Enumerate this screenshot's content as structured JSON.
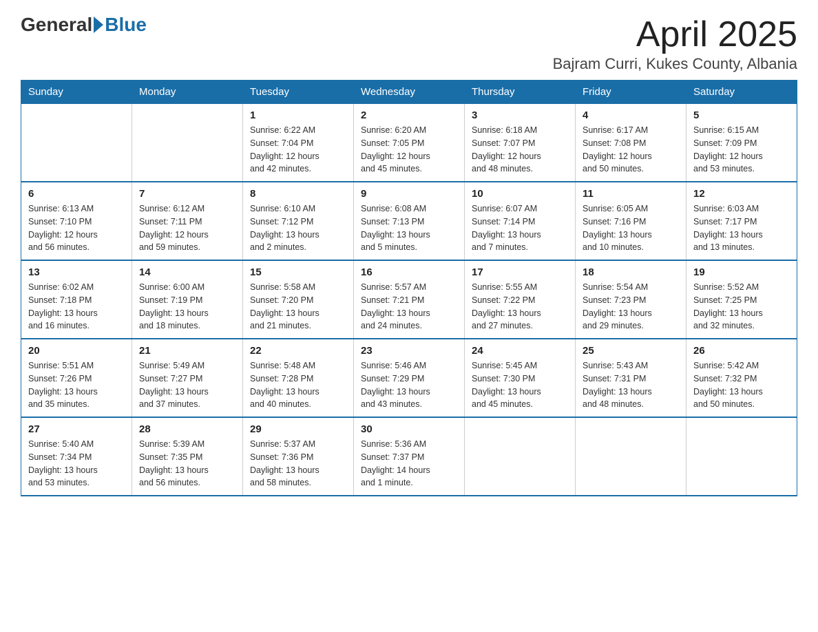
{
  "header": {
    "logo_general": "General",
    "logo_blue": "Blue",
    "month_title": "April 2025",
    "subtitle": "Bajram Curri, Kukes County, Albania"
  },
  "weekdays": [
    "Sunday",
    "Monday",
    "Tuesday",
    "Wednesday",
    "Thursday",
    "Friday",
    "Saturday"
  ],
  "weeks": [
    [
      {
        "day": "",
        "info": ""
      },
      {
        "day": "",
        "info": ""
      },
      {
        "day": "1",
        "info": "Sunrise: 6:22 AM\nSunset: 7:04 PM\nDaylight: 12 hours\nand 42 minutes."
      },
      {
        "day": "2",
        "info": "Sunrise: 6:20 AM\nSunset: 7:05 PM\nDaylight: 12 hours\nand 45 minutes."
      },
      {
        "day": "3",
        "info": "Sunrise: 6:18 AM\nSunset: 7:07 PM\nDaylight: 12 hours\nand 48 minutes."
      },
      {
        "day": "4",
        "info": "Sunrise: 6:17 AM\nSunset: 7:08 PM\nDaylight: 12 hours\nand 50 minutes."
      },
      {
        "day": "5",
        "info": "Sunrise: 6:15 AM\nSunset: 7:09 PM\nDaylight: 12 hours\nand 53 minutes."
      }
    ],
    [
      {
        "day": "6",
        "info": "Sunrise: 6:13 AM\nSunset: 7:10 PM\nDaylight: 12 hours\nand 56 minutes."
      },
      {
        "day": "7",
        "info": "Sunrise: 6:12 AM\nSunset: 7:11 PM\nDaylight: 12 hours\nand 59 minutes."
      },
      {
        "day": "8",
        "info": "Sunrise: 6:10 AM\nSunset: 7:12 PM\nDaylight: 13 hours\nand 2 minutes."
      },
      {
        "day": "9",
        "info": "Sunrise: 6:08 AM\nSunset: 7:13 PM\nDaylight: 13 hours\nand 5 minutes."
      },
      {
        "day": "10",
        "info": "Sunrise: 6:07 AM\nSunset: 7:14 PM\nDaylight: 13 hours\nand 7 minutes."
      },
      {
        "day": "11",
        "info": "Sunrise: 6:05 AM\nSunset: 7:16 PM\nDaylight: 13 hours\nand 10 minutes."
      },
      {
        "day": "12",
        "info": "Sunrise: 6:03 AM\nSunset: 7:17 PM\nDaylight: 13 hours\nand 13 minutes."
      }
    ],
    [
      {
        "day": "13",
        "info": "Sunrise: 6:02 AM\nSunset: 7:18 PM\nDaylight: 13 hours\nand 16 minutes."
      },
      {
        "day": "14",
        "info": "Sunrise: 6:00 AM\nSunset: 7:19 PM\nDaylight: 13 hours\nand 18 minutes."
      },
      {
        "day": "15",
        "info": "Sunrise: 5:58 AM\nSunset: 7:20 PM\nDaylight: 13 hours\nand 21 minutes."
      },
      {
        "day": "16",
        "info": "Sunrise: 5:57 AM\nSunset: 7:21 PM\nDaylight: 13 hours\nand 24 minutes."
      },
      {
        "day": "17",
        "info": "Sunrise: 5:55 AM\nSunset: 7:22 PM\nDaylight: 13 hours\nand 27 minutes."
      },
      {
        "day": "18",
        "info": "Sunrise: 5:54 AM\nSunset: 7:23 PM\nDaylight: 13 hours\nand 29 minutes."
      },
      {
        "day": "19",
        "info": "Sunrise: 5:52 AM\nSunset: 7:25 PM\nDaylight: 13 hours\nand 32 minutes."
      }
    ],
    [
      {
        "day": "20",
        "info": "Sunrise: 5:51 AM\nSunset: 7:26 PM\nDaylight: 13 hours\nand 35 minutes."
      },
      {
        "day": "21",
        "info": "Sunrise: 5:49 AM\nSunset: 7:27 PM\nDaylight: 13 hours\nand 37 minutes."
      },
      {
        "day": "22",
        "info": "Sunrise: 5:48 AM\nSunset: 7:28 PM\nDaylight: 13 hours\nand 40 minutes."
      },
      {
        "day": "23",
        "info": "Sunrise: 5:46 AM\nSunset: 7:29 PM\nDaylight: 13 hours\nand 43 minutes."
      },
      {
        "day": "24",
        "info": "Sunrise: 5:45 AM\nSunset: 7:30 PM\nDaylight: 13 hours\nand 45 minutes."
      },
      {
        "day": "25",
        "info": "Sunrise: 5:43 AM\nSunset: 7:31 PM\nDaylight: 13 hours\nand 48 minutes."
      },
      {
        "day": "26",
        "info": "Sunrise: 5:42 AM\nSunset: 7:32 PM\nDaylight: 13 hours\nand 50 minutes."
      }
    ],
    [
      {
        "day": "27",
        "info": "Sunrise: 5:40 AM\nSunset: 7:34 PM\nDaylight: 13 hours\nand 53 minutes."
      },
      {
        "day": "28",
        "info": "Sunrise: 5:39 AM\nSunset: 7:35 PM\nDaylight: 13 hours\nand 56 minutes."
      },
      {
        "day": "29",
        "info": "Sunrise: 5:37 AM\nSunset: 7:36 PM\nDaylight: 13 hours\nand 58 minutes."
      },
      {
        "day": "30",
        "info": "Sunrise: 5:36 AM\nSunset: 7:37 PM\nDaylight: 14 hours\nand 1 minute."
      },
      {
        "day": "",
        "info": ""
      },
      {
        "day": "",
        "info": ""
      },
      {
        "day": "",
        "info": ""
      }
    ]
  ]
}
